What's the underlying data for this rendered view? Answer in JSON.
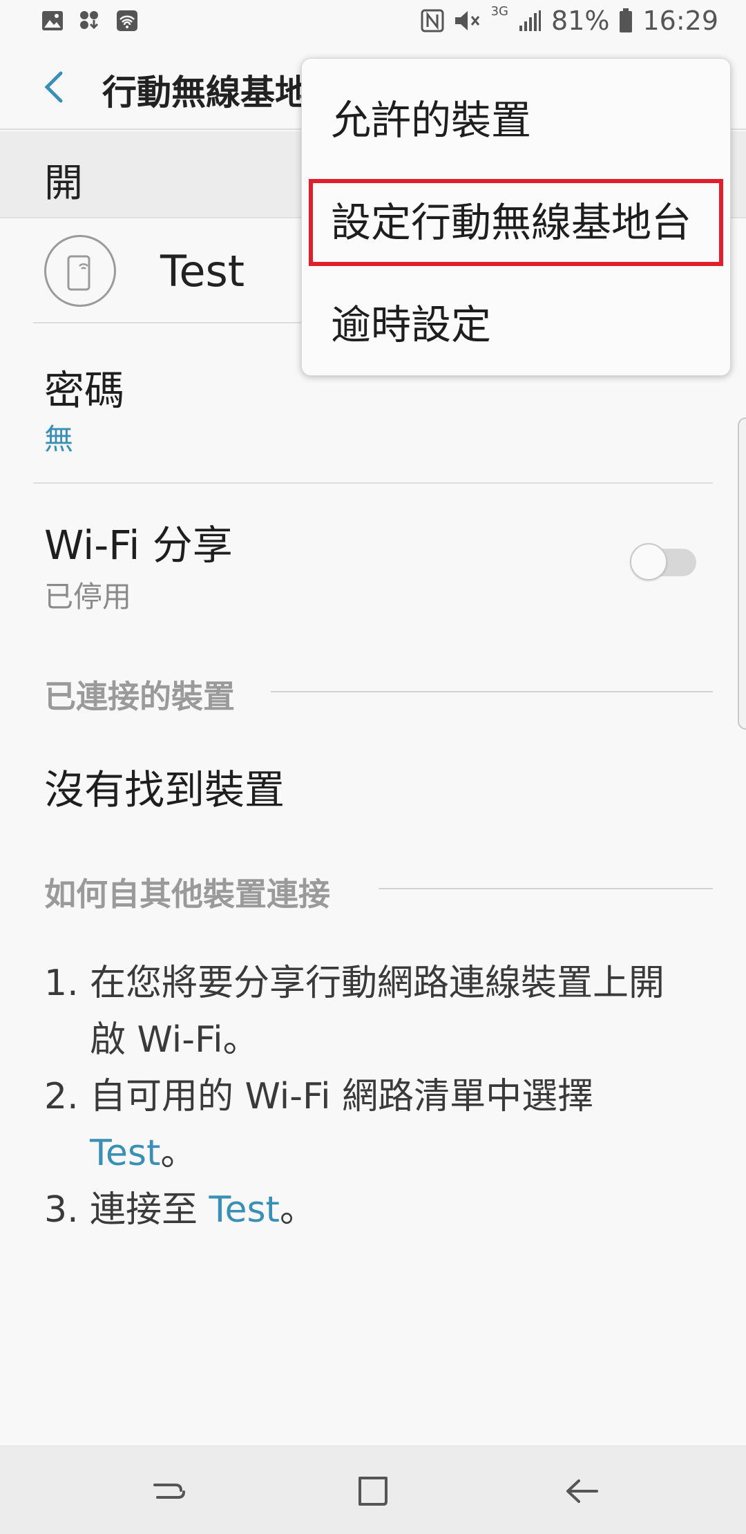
{
  "status_bar": {
    "battery": "81%",
    "time": "16:29",
    "network_type": "3G"
  },
  "app_bar": {
    "title": "行動無線基地台"
  },
  "master_switch": {
    "label": "開"
  },
  "network": {
    "name": "Test"
  },
  "password": {
    "label": "密碼",
    "value": "無"
  },
  "wifi_sharing": {
    "label": "Wi-Fi 分享",
    "status": "已停用",
    "enabled": false
  },
  "connected_devices": {
    "header": "已連接的裝置",
    "empty_text": "沒有找到裝置"
  },
  "how_to_connect": {
    "header": "如何自其他裝置連接",
    "steps": [
      {
        "num": "1.",
        "line1": "在您將要分享行動網路連線裝置上開",
        "line2": "啟 Wi-Fi。"
      },
      {
        "num": "2.",
        "line1": "自可用的 Wi-Fi 網路清單中選擇",
        "link": "Test",
        "suffix": "。"
      },
      {
        "num": "3.",
        "prefix": "連接至 ",
        "link": "Test",
        "suffix": "。"
      }
    ]
  },
  "overflow_menu": {
    "items": [
      {
        "label": "允許的裝置"
      },
      {
        "label": "設定行動無線基地台"
      },
      {
        "label": "逾時設定"
      }
    ],
    "highlighted_index": 1
  },
  "colors": {
    "accent_blue": "#3a8fb5",
    "highlight_red": "#e01e2c"
  }
}
